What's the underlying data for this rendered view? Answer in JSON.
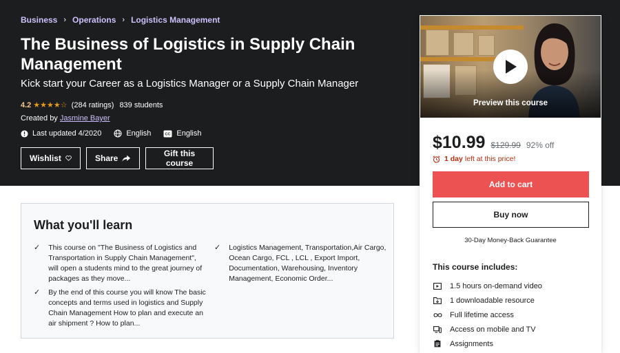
{
  "breadcrumb": [
    "Business",
    "Operations",
    "Logistics Management"
  ],
  "course": {
    "title": "The Business of Logistics in Supply Chain Management",
    "subtitle": "Kick start your Career as a Logistics Manager or a Supply Chain Manager",
    "rating": "4.2",
    "rating_stars": 4.2,
    "ratings_count": "(284 ratings)",
    "students": "839 students",
    "created_by_label": "Created by",
    "instructor": "Jasmine Bayer",
    "last_updated": "Last updated 4/2020",
    "language": "English",
    "captions": "English"
  },
  "actions": {
    "wishlist": "Wishlist",
    "share": "Share",
    "gift": "Gift this course"
  },
  "preview": {
    "label": "Preview this course"
  },
  "pricing": {
    "price": "$10.99",
    "original": "$129.99",
    "discount": "92% off",
    "timer_bold": "1 day",
    "timer_rest": "left at this price!",
    "add_to_cart": "Add to cart",
    "buy_now": "Buy now",
    "guarantee": "30-Day Money-Back Guarantee"
  },
  "includes": {
    "title": "This course includes:",
    "items": [
      {
        "icon": "video-icon",
        "text": "1.5 hours on-demand video"
      },
      {
        "icon": "file-download-icon",
        "text": "1 downloadable resource"
      },
      {
        "icon": "infinity-icon",
        "text": "Full lifetime access"
      },
      {
        "icon": "mobile-tv-icon",
        "text": "Access on mobile and TV"
      },
      {
        "icon": "assignment-icon",
        "text": "Assignments"
      }
    ]
  },
  "learn": {
    "title": "What you'll learn",
    "items": [
      "This course on \"The Business of Logistics and Transportation in Supply Chain Management\", will open a students mind to the great journey of packages as they move...",
      "Logistics Management, Transportation,Air Cargo, Ocean Cargo, FCL , LCL , Export Import, Documentation, Warehousing, Inventory Management, Economic Order...",
      "By the end of this course you will know The basic concepts and terms used in logistics and Supply Chain Management How to plan and execute an air shipment ? How to plan..."
    ]
  },
  "colors": {
    "hero_bg": "#1c1d1f",
    "accent_link": "#cec0fc",
    "star": "#e59819",
    "cart": "#ec5252",
    "timer": "#b32d0f"
  }
}
